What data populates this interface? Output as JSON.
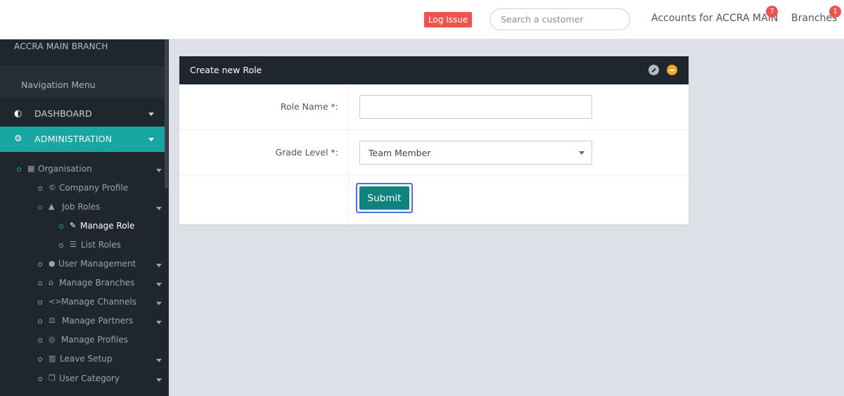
{
  "topbar": {
    "log_issue": "Log Issue",
    "search_placeholder": "Search a customer",
    "accounts_link": "Accounts for ACCRA MAIN",
    "accounts_badge": "7",
    "branches_link": "Branches",
    "branches_badge": "1"
  },
  "sidebar": {
    "branch_name": "ACCRA MAIN BRANCH",
    "nav_heading": "Navigation Menu",
    "dashboard": "DASHBOARD",
    "administration": "ADMINISTRATION",
    "items": [
      {
        "label": "Organisation",
        "icon": "building-icon"
      },
      {
        "label": "Company Profile",
        "icon": "copyright-icon"
      },
      {
        "label": "Job Roles",
        "icon": "graduation-cap-icon"
      },
      {
        "label": "Manage Role",
        "icon": "edit-icon"
      },
      {
        "label": "List Roles",
        "icon": "list-icon"
      },
      {
        "label": "User Management",
        "icon": "user-icon"
      },
      {
        "label": "Manage Branches",
        "icon": "home-icon"
      },
      {
        "label": "Manage Channels",
        "icon": "code-icon"
      },
      {
        "label": "Manage Partners",
        "icon": "balance-scale-icon"
      },
      {
        "label": "Manage Profiles",
        "icon": "life-ring-icon"
      },
      {
        "label": "Leave Setup",
        "icon": "map-icon"
      },
      {
        "label": "User Category",
        "icon": "clone-icon"
      }
    ]
  },
  "panel": {
    "title": "Create new Role",
    "role_name_label": "Role Name *:",
    "role_name_value": "",
    "grade_level_label": "Grade Level *:",
    "grade_level_value": "Team Member",
    "submit_label": "Submit"
  },
  "colors": {
    "accent": "#16a7a2",
    "submit": "#11837f",
    "sidebar_bg": "#20262e",
    "danger": "#f0534f",
    "warning": "#f5a623"
  }
}
